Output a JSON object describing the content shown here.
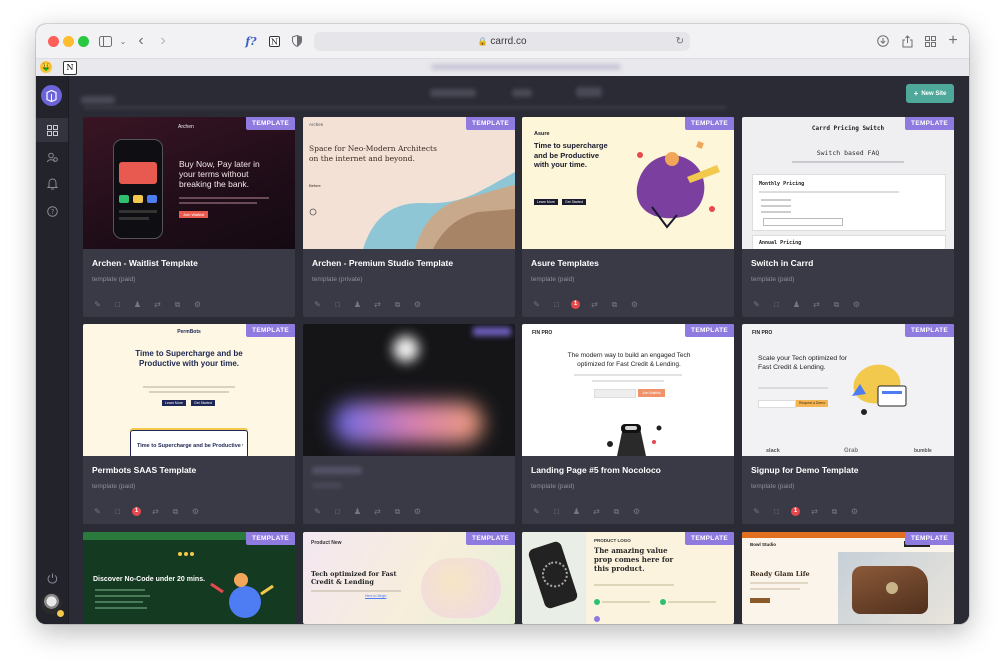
{
  "browser": {
    "url": "carrd.co",
    "lights": [
      "#ff5f57",
      "#febc2e",
      "#28c840"
    ]
  },
  "topbar": {
    "new_site_label": "New Site"
  },
  "cards": [
    {
      "title": "Archen - Waitlist Template",
      "subtitle": "template (paid)",
      "badge": "TEMPLATE",
      "has_alert": false,
      "preview": {
        "headline": "Buy Now, Pay later in your terms without breaking the bank.",
        "brand": "Archen",
        "button": "Join Waitlist"
      }
    },
    {
      "title": "Archen - Premium Studio Template",
      "subtitle": "template (private)",
      "badge": "TEMPLATE",
      "has_alert": false,
      "preview": {
        "brand": "Archen",
        "headline": "Space for Neo-Modern Architects on the internet and beyond.",
        "link": "Before"
      }
    },
    {
      "title": "Asure Templates",
      "subtitle": "template (paid)",
      "badge": "TEMPLATE",
      "has_alert": true,
      "alert_count": "1",
      "preview": {
        "brand": "Asure",
        "headline": "Time to supercharge and be Productive with your time.",
        "button1": "Learn More",
        "button2": "Get Started"
      }
    },
    {
      "title": "Switch in Carrd",
      "subtitle": "template (paid)",
      "badge": "TEMPLATE",
      "has_alert": false,
      "preview": {
        "heading": "Carrd Pricing Switch",
        "sub": "Switch based FAQ",
        "section": "Monthly Pricing",
        "section2": "Annual Pricing"
      }
    },
    {
      "title": "Permbots SAAS Template",
      "subtitle": "template (paid)",
      "badge": "TEMPLATE",
      "has_alert": true,
      "alert_count": "1",
      "preview": {
        "brand": "PermBots",
        "headline": "Time to Supercharge and be Productive with your time.",
        "button1": "Learn More",
        "button2": "Get Started",
        "card_text": "Time to Supercharge and be Productive with"
      }
    },
    {
      "title": "",
      "subtitle": "",
      "badge": "",
      "has_alert": false,
      "preview": {}
    },
    {
      "title": "Landing Page #5 from Nocoloco",
      "subtitle": "template (paid)",
      "badge": "TEMPLATE",
      "has_alert": false,
      "preview": {
        "brand": "FIN PRO",
        "headline": "The modern way to build an engaged Tech optimized for Fast Credit & Lending.",
        "button": "Join Waitlist"
      }
    },
    {
      "title": "Signup for Demo Template",
      "subtitle": "template (paid)",
      "badge": "TEMPLATE",
      "has_alert": true,
      "alert_count": "1",
      "preview": {
        "brand": "FIN PRO",
        "headline": "Scale your Tech optimized for Fast Credit & Lending.",
        "button": "Request a Demo",
        "logos": [
          "slack",
          "Grab",
          "bumble"
        ]
      }
    },
    {
      "title": "",
      "subtitle": "",
      "badge": "TEMPLATE",
      "has_alert": false,
      "preview": {
        "headline": "Discover No-Code under 20 mins."
      }
    },
    {
      "title": "",
      "subtitle": "",
      "badge": "TEMPLATE",
      "has_alert": false,
      "preview": {
        "brand": "Product New",
        "headline": "Tech optimized for Fast Credit & Lending",
        "link": "Here to Begin"
      }
    },
    {
      "title": "",
      "subtitle": "",
      "badge": "TEMPLATE",
      "has_alert": false,
      "preview": {
        "brand": "PRODUCT LOGO",
        "headline": "The amazing value prop comes here for this product."
      }
    },
    {
      "title": "",
      "subtitle": "",
      "badge": "TEMPLATE",
      "has_alert": false,
      "preview": {
        "brand": "Bowl Studio",
        "headline": "Ready Glam Life"
      }
    }
  ],
  "colors": {
    "accent": "#8f7ae0",
    "new_site": "#4ea99b",
    "alert": "#e5484d"
  },
  "icons": [
    "edit-icon",
    "comment-icon",
    "users-icon",
    "transfer-icon",
    "duplicate-icon",
    "settings-icon"
  ]
}
